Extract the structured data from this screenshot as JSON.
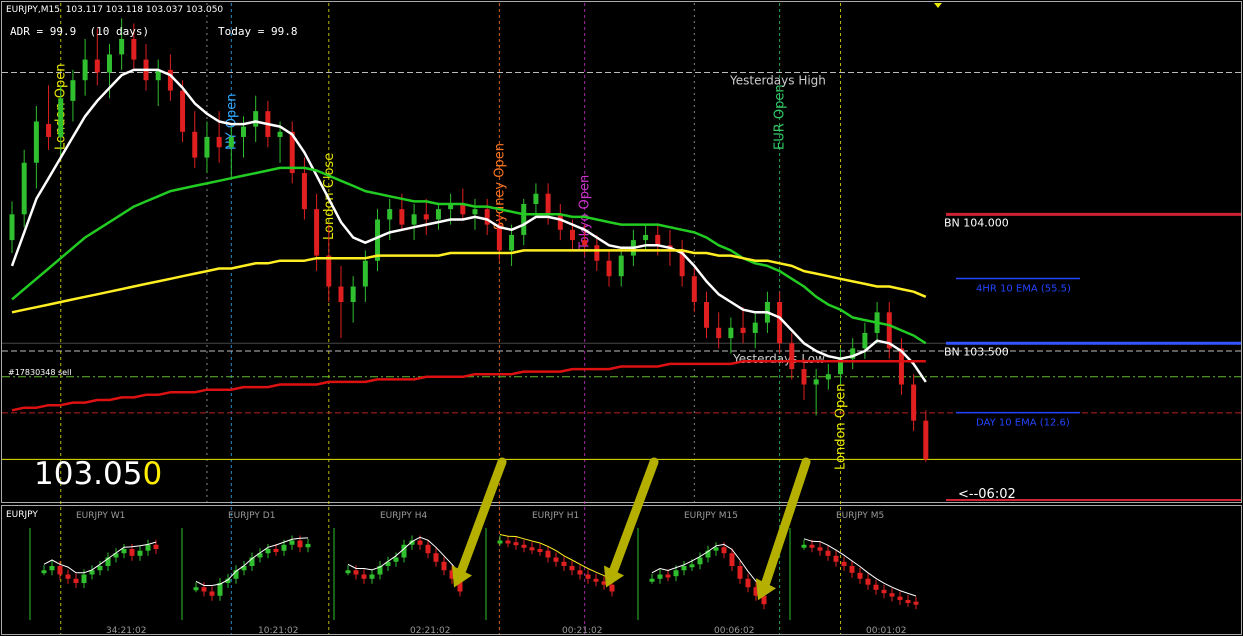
{
  "header": {
    "symbol_line": "EURJPY,M15  103.117 103.118 103.037 103.050",
    "adr": "ADR = 99.9  (10 days)",
    "today": "Today = 99.8"
  },
  "price": {
    "big_main": "103.05",
    "big_last_digit": "0",
    "countdown": "<--06:02"
  },
  "colors": {
    "background": "#000000",
    "bull": "#2fbf2f",
    "bear": "#e02020",
    "ema_fast": "#ffffff",
    "ema_mid": "#22cc22",
    "ema_slow": "#ffee22",
    "ema_day": "#dd1111",
    "session_london": "#e8e800",
    "session_ny": "#33aaff",
    "session_sydney": "#ff7722",
    "session_tokyo": "#cc33cc",
    "session_eur": "#33cc66",
    "level_blue": "#2255ff",
    "level_red": "#cc2222",
    "arrow": "#b5b000"
  },
  "levels": [
    {
      "label": "Yesterdays High",
      "price": 104.55,
      "color": "#bbbbbb",
      "style": "dash"
    },
    {
      "label": "BN  104.000",
      "price": 104.0,
      "color": "#cc2233",
      "style": "right-solid"
    },
    {
      "label": "4HR 10 EMA (55.5)",
      "price": 103.72,
      "color": "#2244ff",
      "style": "right-short"
    },
    {
      "label": "BN  103.500",
      "price": 103.5,
      "color": "#3355ff",
      "style": "right-solid"
    },
    {
      "label": "Yesterdays Low",
      "price": 103.47,
      "color": "#bbbbbb",
      "style": "dash"
    },
    {
      "label": "#17830348 sell",
      "price": 103.37,
      "color": "#66bb33",
      "style": "dashdot"
    },
    {
      "label": "",
      "price": 103.23,
      "color": "#bb2222",
      "style": "dash"
    },
    {
      "label": "DAY 10 EMA (12.6)",
      "price": 103.2,
      "color": "#2244ff",
      "style": "right-short"
    },
    {
      "label": "",
      "price": 103.05,
      "color": "#e8e800",
      "style": "solid"
    }
  ],
  "sessions": [
    {
      "label": "London Open",
      "index": 4,
      "color": "#e8e800"
    },
    {
      "label": "NY Open",
      "index": 18,
      "color": "#33aaff"
    },
    {
      "label": "London Close",
      "index": 26,
      "color": "#e8e800"
    },
    {
      "label": "Sydney Open",
      "index": 40,
      "color": "#ff7722"
    },
    {
      "label": "Tokyo Open",
      "index": 47,
      "color": "#cc33cc"
    },
    {
      "label": "EUR Open",
      "index": 63,
      "color": "#33cc66"
    },
    {
      "label": "London Open",
      "index": 68,
      "color": "#e8e800"
    }
  ],
  "chart_data": {
    "type": "candlestick",
    "title": "EURJPY,M15",
    "ylim": [
      102.9,
      104.8
    ],
    "candles": [
      [
        103.9,
        104.05,
        103.85,
        104.0
      ],
      [
        104.0,
        104.25,
        103.95,
        104.2
      ],
      [
        104.2,
        104.42,
        104.1,
        104.36
      ],
      [
        104.35,
        104.5,
        104.25,
        104.3
      ],
      [
        104.3,
        104.5,
        104.22,
        104.45
      ],
      [
        104.44,
        104.56,
        104.36,
        104.52
      ],
      [
        104.52,
        104.68,
        104.46,
        104.6
      ],
      [
        104.6,
        104.72,
        104.5,
        104.55
      ],
      [
        104.55,
        104.66,
        104.45,
        104.62
      ],
      [
        104.62,
        104.76,
        104.56,
        104.68
      ],
      [
        104.68,
        104.74,
        104.56,
        104.6
      ],
      [
        104.6,
        104.66,
        104.48,
        104.52
      ],
      [
        104.52,
        104.6,
        104.42,
        104.56
      ],
      [
        104.56,
        104.62,
        104.44,
        104.48
      ],
      [
        104.48,
        104.52,
        104.28,
        104.32
      ],
      [
        104.32,
        104.4,
        104.18,
        104.22
      ],
      [
        104.22,
        104.36,
        104.16,
        104.3
      ],
      [
        104.3,
        104.4,
        104.2,
        104.26
      ],
      [
        104.26,
        104.34,
        104.14,
        104.3
      ],
      [
        104.3,
        104.38,
        104.22,
        104.34
      ],
      [
        104.34,
        104.46,
        104.28,
        104.4
      ],
      [
        104.4,
        104.44,
        104.26,
        104.3
      ],
      [
        104.3,
        104.36,
        104.2,
        104.32
      ],
      [
        104.32,
        104.36,
        104.12,
        104.16
      ],
      [
        104.16,
        104.22,
        103.98,
        104.02
      ],
      [
        104.02,
        104.08,
        103.78,
        103.84
      ],
      [
        103.84,
        103.96,
        103.66,
        103.72
      ],
      [
        103.72,
        103.8,
        103.52,
        103.66
      ],
      [
        103.66,
        103.76,
        103.58,
        103.72
      ],
      [
        103.72,
        103.86,
        103.66,
        103.82
      ],
      [
        103.82,
        104.02,
        103.78,
        103.98
      ],
      [
        103.98,
        104.06,
        103.9,
        104.02
      ],
      [
        104.02,
        104.08,
        103.94,
        103.96
      ],
      [
        103.96,
        104.04,
        103.9,
        104.0
      ],
      [
        104.0,
        104.06,
        103.92,
        103.98
      ],
      [
        103.98,
        104.04,
        103.94,
        104.02
      ],
      [
        104.02,
        104.08,
        103.96,
        104.04
      ],
      [
        104.04,
        104.1,
        103.98,
        104.0
      ],
      [
        104.0,
        104.06,
        103.94,
        104.02
      ],
      [
        104.02,
        104.06,
        103.92,
        103.96
      ],
      [
        103.96,
        104.0,
        103.82,
        103.86
      ],
      [
        103.86,
        103.96,
        103.8,
        103.92
      ],
      [
        103.92,
        104.06,
        103.88,
        104.04
      ],
      [
        104.04,
        104.12,
        104.0,
        104.08
      ],
      [
        104.08,
        104.12,
        103.96,
        104.0
      ],
      [
        104.0,
        104.04,
        103.9,
        103.94
      ],
      [
        103.94,
        103.98,
        103.86,
        103.9
      ],
      [
        103.9,
        103.96,
        103.84,
        103.88
      ],
      [
        103.88,
        103.92,
        103.78,
        103.82
      ],
      [
        103.82,
        103.86,
        103.72,
        103.76
      ],
      [
        103.76,
        103.86,
        103.72,
        103.84
      ],
      [
        103.84,
        103.94,
        103.8,
        103.9
      ],
      [
        103.9,
        103.96,
        103.86,
        103.92
      ],
      [
        103.92,
        103.96,
        103.84,
        103.88
      ],
      [
        103.88,
        103.94,
        103.8,
        103.86
      ],
      [
        103.86,
        103.9,
        103.72,
        103.76
      ],
      [
        103.76,
        103.8,
        103.62,
        103.66
      ],
      [
        103.66,
        103.7,
        103.52,
        103.56
      ],
      [
        103.56,
        103.62,
        103.48,
        103.52
      ],
      [
        103.52,
        103.6,
        103.46,
        103.56
      ],
      [
        103.56,
        103.64,
        103.5,
        103.54
      ],
      [
        103.54,
        103.62,
        103.48,
        103.58
      ],
      [
        103.58,
        103.7,
        103.54,
        103.66
      ],
      [
        103.66,
        103.7,
        103.46,
        103.5
      ],
      [
        103.5,
        103.54,
        103.36,
        103.4
      ],
      [
        103.4,
        103.44,
        103.28,
        103.34
      ],
      [
        103.34,
        103.4,
        103.22,
        103.36
      ],
      [
        103.36,
        103.42,
        103.32,
        103.38
      ],
      [
        103.38,
        103.48,
        103.34,
        103.44
      ],
      [
        103.44,
        103.52,
        103.4,
        103.48
      ],
      [
        103.48,
        103.58,
        103.44,
        103.54
      ],
      [
        103.54,
        103.66,
        103.5,
        103.62
      ],
      [
        103.62,
        103.66,
        103.44,
        103.48
      ],
      [
        103.48,
        103.52,
        103.3,
        103.34
      ],
      [
        103.34,
        103.38,
        103.16,
        103.2
      ],
      [
        103.2,
        103.24,
        103.04,
        103.05
      ]
    ],
    "series": [
      {
        "name": "ema_fast",
        "color": "#ffffff",
        "values": [
          103.8,
          103.93,
          104.06,
          104.14,
          104.22,
          104.3,
          104.38,
          104.44,
          104.49,
          104.54,
          104.56,
          104.56,
          104.56,
          104.54,
          104.49,
          104.43,
          104.39,
          104.36,
          104.35,
          104.35,
          104.36,
          104.35,
          104.34,
          104.31,
          104.24,
          104.15,
          104.06,
          103.97,
          103.91,
          103.89,
          103.91,
          103.93,
          103.94,
          103.95,
          103.96,
          103.97,
          103.98,
          103.98,
          103.99,
          103.98,
          103.95,
          103.94,
          103.96,
          103.99,
          103.99,
          103.98,
          103.96,
          103.94,
          103.91,
          103.88,
          103.87,
          103.87,
          103.88,
          103.88,
          103.87,
          103.85,
          103.8,
          103.74,
          103.69,
          103.66,
          103.63,
          103.62,
          103.62,
          103.6,
          103.55,
          103.5,
          103.47,
          103.45,
          103.44,
          103.45,
          103.47,
          103.51,
          103.5,
          103.47,
          103.42,
          103.35
        ]
      },
      {
        "name": "ema_mid",
        "color": "#22cc22",
        "values": [
          103.67,
          103.71,
          103.75,
          103.79,
          103.83,
          103.87,
          103.91,
          103.94,
          103.97,
          104.0,
          104.03,
          104.05,
          104.07,
          104.09,
          104.1,
          104.11,
          104.12,
          104.13,
          104.14,
          104.15,
          104.16,
          104.17,
          104.18,
          104.18,
          104.18,
          104.17,
          104.15,
          104.13,
          104.11,
          104.09,
          104.08,
          104.07,
          104.06,
          104.05,
          104.05,
          104.04,
          104.04,
          104.04,
          104.03,
          104.03,
          104.02,
          104.01,
          104.0,
          104.0,
          104.0,
          104.0,
          103.99,
          103.99,
          103.98,
          103.97,
          103.96,
          103.96,
          103.96,
          103.96,
          103.95,
          103.94,
          103.93,
          103.91,
          103.88,
          103.86,
          103.83,
          103.81,
          103.8,
          103.78,
          103.75,
          103.72,
          103.68,
          103.65,
          103.63,
          103.6,
          103.59,
          103.58,
          103.57,
          103.55,
          103.53,
          103.5
        ]
      },
      {
        "name": "ema_slow",
        "color": "#ffee22",
        "values": [
          103.62,
          103.63,
          103.64,
          103.65,
          103.66,
          103.67,
          103.68,
          103.69,
          103.7,
          103.71,
          103.72,
          103.73,
          103.74,
          103.75,
          103.76,
          103.77,
          103.78,
          103.79,
          103.79,
          103.8,
          103.81,
          103.81,
          103.82,
          103.82,
          103.82,
          103.83,
          103.83,
          103.83,
          103.83,
          103.83,
          103.84,
          103.84,
          103.84,
          103.84,
          103.84,
          103.84,
          103.85,
          103.85,
          103.85,
          103.85,
          103.85,
          103.85,
          103.86,
          103.86,
          103.86,
          103.86,
          103.86,
          103.86,
          103.86,
          103.86,
          103.86,
          103.86,
          103.86,
          103.86,
          103.86,
          103.86,
          103.85,
          103.85,
          103.84,
          103.84,
          103.83,
          103.82,
          103.82,
          103.81,
          103.8,
          103.78,
          103.77,
          103.76,
          103.75,
          103.74,
          103.73,
          103.72,
          103.72,
          103.71,
          103.7,
          103.68
        ]
      },
      {
        "name": "ema_day",
        "color": "#dd1111",
        "values": [
          103.24,
          103.25,
          103.25,
          103.26,
          103.26,
          103.27,
          103.27,
          103.28,
          103.28,
          103.29,
          103.29,
          103.3,
          103.3,
          103.31,
          103.31,
          103.31,
          103.32,
          103.32,
          103.32,
          103.33,
          103.33,
          103.33,
          103.34,
          103.34,
          103.34,
          103.34,
          103.35,
          103.35,
          103.35,
          103.35,
          103.36,
          103.36,
          103.36,
          103.36,
          103.37,
          103.37,
          103.37,
          103.37,
          103.38,
          103.38,
          103.38,
          103.38,
          103.39,
          103.39,
          103.39,
          103.39,
          103.4,
          103.4,
          103.4,
          103.4,
          103.41,
          103.41,
          103.41,
          103.41,
          103.42,
          103.42,
          103.42,
          103.42,
          103.42,
          103.42,
          103.43,
          103.43,
          103.43,
          103.43,
          103.43,
          103.43,
          103.43,
          103.43,
          103.43,
          103.43,
          103.43,
          103.43,
          103.43,
          103.43,
          103.43,
          103.43
        ]
      }
    ]
  },
  "mini_panel": {
    "label": "EURJPY",
    "panels": [
      {
        "title": "EURJPY  W1",
        "time": "34:21:02",
        "trend": [
          0.55,
          0.6,
          0.5,
          0.45,
          0.4,
          0.5,
          0.55,
          0.6,
          0.7,
          0.75,
          0.8,
          0.72,
          0.78,
          0.85,
          0.8
        ],
        "ma": "white",
        "arrow": false
      },
      {
        "title": "EURJPY  D1",
        "time": "10:21:02",
        "trend": [
          0.35,
          0.3,
          0.25,
          0.4,
          0.45,
          0.55,
          0.6,
          0.7,
          0.75,
          0.8,
          0.78,
          0.85,
          0.9,
          0.82,
          0.86
        ],
        "ma": "white",
        "arrow": false
      },
      {
        "title": "EURJPY  H4",
        "time": "02:21:02",
        "trend": [
          0.55,
          0.5,
          0.45,
          0.5,
          0.6,
          0.65,
          0.7,
          0.85,
          0.9,
          0.85,
          0.75,
          0.65,
          0.55,
          0.45,
          0.3
        ],
        "ma": "white",
        "arrow": true
      },
      {
        "title": "EURJPY  H1",
        "time": "00:21:02",
        "trend": [
          0.9,
          0.88,
          0.85,
          0.82,
          0.8,
          0.78,
          0.7,
          0.65,
          0.6,
          0.55,
          0.5,
          0.45,
          0.42,
          0.38,
          0.3
        ],
        "ma": "yellow",
        "arrow": true
      },
      {
        "title": "EURJPY  M15",
        "time": "00:06:02",
        "trend": [
          0.45,
          0.5,
          0.48,
          0.55,
          0.6,
          0.62,
          0.7,
          0.78,
          0.82,
          0.75,
          0.6,
          0.45,
          0.35,
          0.25,
          0.15
        ],
        "ma": "white",
        "arrow": true
      },
      {
        "title": "EURJPY  M5",
        "time": "00:01:02",
        "trend": [
          0.85,
          0.82,
          0.78,
          0.72,
          0.65,
          0.6,
          0.52,
          0.45,
          0.38,
          0.32,
          0.28,
          0.24,
          0.2,
          0.18,
          0.15
        ],
        "ma": "white",
        "arrow": false
      }
    ]
  }
}
